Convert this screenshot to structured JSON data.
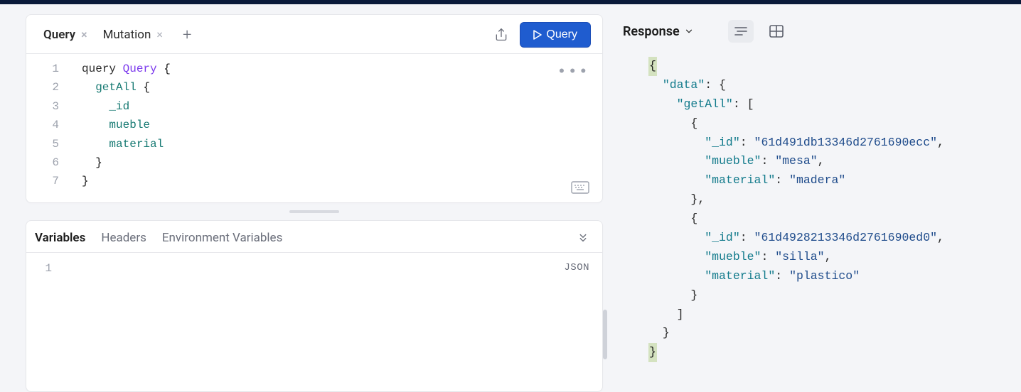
{
  "tabs": [
    {
      "label": "Query",
      "active": true
    },
    {
      "label": "Mutation",
      "active": false
    }
  ],
  "runButton": {
    "label": "Query"
  },
  "query": {
    "lines": [
      "1",
      "2",
      "3",
      "4",
      "5",
      "6",
      "7"
    ],
    "keyword": "query",
    "operationName": "Query",
    "rootField": "getAll",
    "fields": [
      "_id",
      "mueble",
      "material"
    ]
  },
  "varsTabs": [
    {
      "label": "Variables",
      "active": true
    },
    {
      "label": "Headers",
      "active": false
    },
    {
      "label": "Environment Variables",
      "active": false
    }
  ],
  "varsGutter": "1",
  "varsFormat": "JSON",
  "response": {
    "title": "Response",
    "json": {
      "data": {
        "getAll": [
          {
            "_id": "61d491db13346d2761690ecc",
            "mueble": "mesa",
            "material": "madera"
          },
          {
            "_id": "61d4928213346d2761690ed0",
            "mueble": "silla",
            "material": "plastico"
          }
        ]
      }
    }
  }
}
